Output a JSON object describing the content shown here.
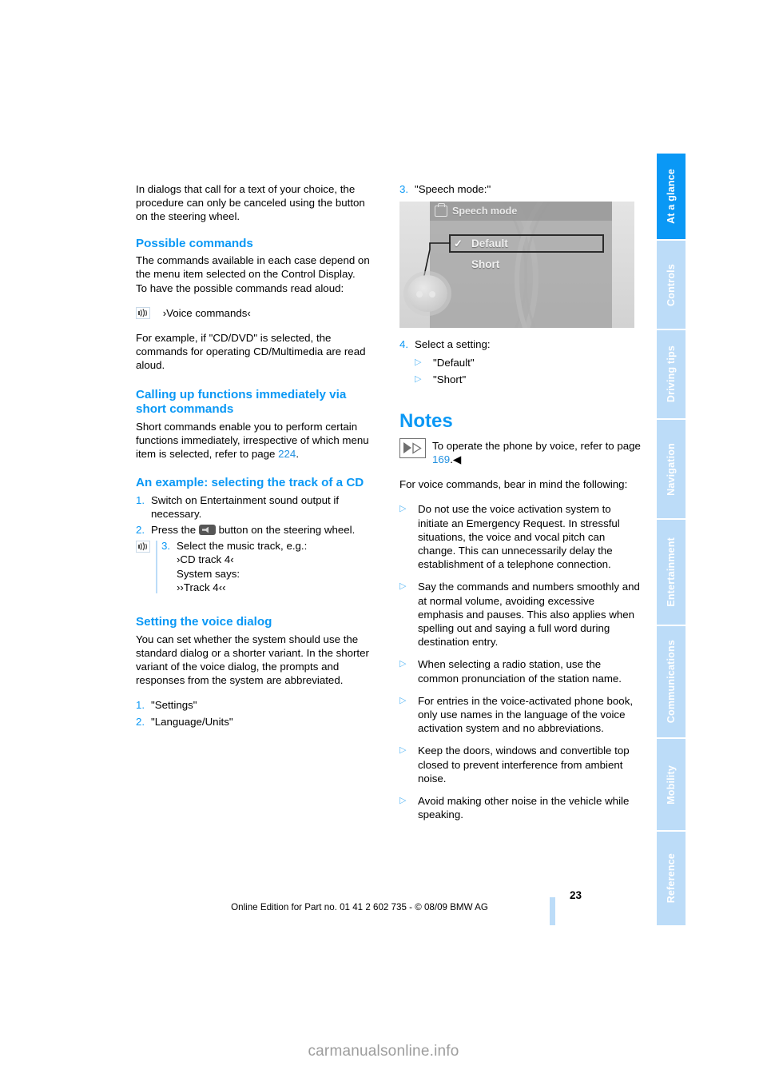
{
  "document": {
    "page_number": "23",
    "imprint": "Online Edition for Part no. 01 41 2 602 735 - © 08/09 BMW AG",
    "watermark": "carmanualsonline.info",
    "accent_color": "#0a98f5",
    "tab_inactive_color": "#bcdcf8"
  },
  "sidebar": {
    "tabs": [
      {
        "label": "At a glance",
        "active": true
      },
      {
        "label": "Controls",
        "active": false
      },
      {
        "label": "Driving tips",
        "active": false
      },
      {
        "label": "Navigation",
        "active": false
      },
      {
        "label": "Entertainment",
        "active": false
      },
      {
        "label": "Communications",
        "active": false
      },
      {
        "label": "Mobility",
        "active": false
      },
      {
        "label": "Reference",
        "active": false
      }
    ]
  },
  "left_column": {
    "intro": "In dialogs that call for a text of your choice, the procedure can only be canceled using the button on the steering wheel.",
    "possible_commands": {
      "heading": "Possible commands",
      "body": "The commands available in each case depend on the menu item selected on the Control Display.",
      "body2": "To have the possible commands read aloud:",
      "command": "›Voice commands‹",
      "after": "For example, if \"CD/DVD\" is selected, the commands for operating CD/Multimedia are read aloud."
    },
    "short_commands": {
      "heading": "Calling up functions immediately via short commands",
      "body_pre": "Short commands enable you to perform certain functions immediately, irrespective of which menu item is selected, refer to page ",
      "page_ref": "224",
      "body_post": "."
    },
    "example": {
      "heading": "An example: selecting the track of a CD",
      "step1_num": "1.",
      "step1_text": "Switch on Entertainment sound output if necessary.",
      "step2_num": "2.",
      "step2_text_pre": "Press the ",
      "step2_text_post": " button on the steering wheel.",
      "step3_num": "3.",
      "step3_text": "Select the music track, e.g.:",
      "step3_command": "›CD track 4‹",
      "step3_system": "System says:",
      "step3_response": "››Track 4‹‹"
    },
    "voice_dialog": {
      "heading": "Setting the voice dialog",
      "body": "You can set whether the system should use the standard dialog or a shorter variant. In the shorter variant of the voice dialog, the prompts and responses from the system are abbreviated.",
      "step1_num": "1.",
      "step1_text": "\"Settings\"",
      "step2_num": "2.",
      "step2_text": "\"Language/Units\""
    }
  },
  "right_column": {
    "step3_num": "3.",
    "step3_text": "\"Speech mode:\"",
    "control_display": {
      "title": "Speech mode",
      "option_selected": "Default",
      "option_other": "Short",
      "checkmark": "✓"
    },
    "step4_num": "4.",
    "step4_text": "Select a setting:",
    "step4_options": [
      "\"Default\"",
      "\"Short\""
    ],
    "notes": {
      "heading": "Notes",
      "note_pre": "To operate the phone by voice, refer to page ",
      "note_page": "169",
      "note_post": ".◀",
      "intro": "For voice commands, bear in mind the following:",
      "bullets": [
        "Do not use the voice activation system to initiate an Emergency Request. In stressful situations, the voice and vocal pitch can change. This can unnecessarily delay the establishment of a telephone connection.",
        "Say the commands and numbers smoothly and at normal volume, avoiding excessive emphasis and pauses. This also applies when spelling out and saying a full word during destination entry.",
        "When selecting a radio station, use the common pronunciation of the station name.",
        "For entries in the voice-activated phone book, only use names in the language of the voice activation system and no abbreviations.",
        "Keep the doors, windows and convertible top closed to prevent interference from ambient noise.",
        "Avoid making other noise in the vehicle while speaking."
      ]
    }
  },
  "icons": {
    "voice": "voice-command-icon",
    "wheel_button": "steering-wheel-voice-button-icon",
    "note": "note-triangle-icon",
    "bullet": "▷"
  }
}
